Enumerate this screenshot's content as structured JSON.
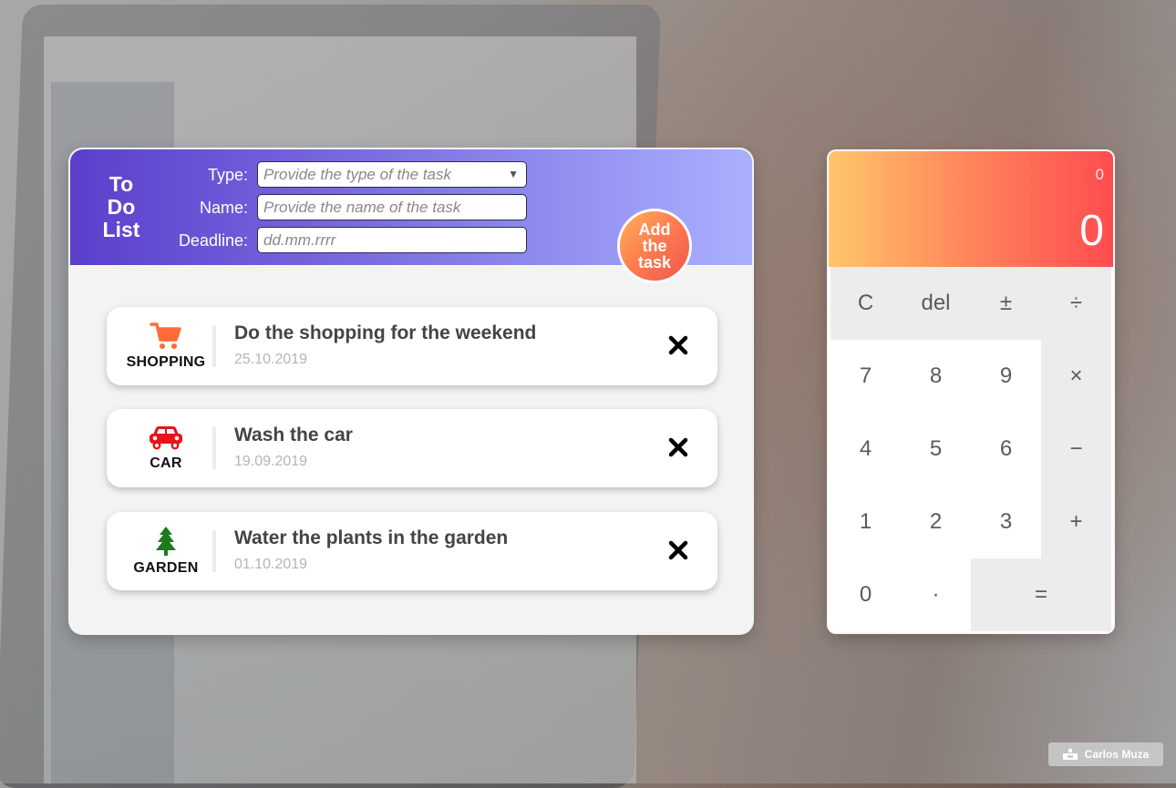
{
  "todo": {
    "title_lines": [
      "To",
      "Do",
      "List"
    ],
    "fields": {
      "type_label": "Type:",
      "type_placeholder": "Provide the type of the task",
      "name_label": "Name:",
      "name_placeholder": "Provide the name of the task",
      "deadline_label": "Deadline:",
      "deadline_placeholder": "dd.mm.rrrr"
    },
    "add_button_lines": [
      "Add",
      "the",
      "task"
    ],
    "tasks": [
      {
        "category": "SHOPPING",
        "icon": "cart-icon",
        "icon_color": "#ff6b35",
        "name": "Do the shopping for the weekend",
        "date": "25.10.2019"
      },
      {
        "category": "CAR",
        "icon": "car-icon",
        "icon_color": "#e8141a",
        "name": "Wash the car",
        "date": "19.09.2019"
      },
      {
        "category": "GARDEN",
        "icon": "tree-icon",
        "icon_color": "#1f7a1f",
        "name": "Water the plants in the garden",
        "date": "01.10.2019"
      }
    ],
    "colors": {
      "header_gradient_start": "#5b3fcc",
      "header_gradient_end": "#aab0ff",
      "add_button_start": "#ffb259",
      "add_button_end": "#f0564e"
    }
  },
  "calculator": {
    "previous": "0",
    "current": "0",
    "keys": {
      "clear": "C",
      "del": "del",
      "sign": "±",
      "divide": "÷",
      "seven": "7",
      "eight": "8",
      "nine": "9",
      "multiply": "×",
      "four": "4",
      "five": "5",
      "six": "6",
      "minus": "−",
      "one": "1",
      "two": "2",
      "three": "3",
      "plus": "+",
      "zero": "0",
      "dot": "·",
      "equals": "="
    },
    "colors": {
      "display_gradient_start": "#ffc66b",
      "display_gradient_end": "#ff4c50"
    }
  },
  "credit": "Carlos Muza"
}
